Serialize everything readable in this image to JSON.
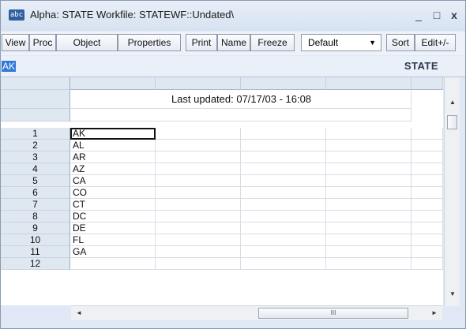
{
  "window": {
    "icon_text": "abc",
    "title": "Alpha: STATE   Workfile: STATEWF::Undated\\"
  },
  "title_controls": {
    "minimize": "_",
    "maximize": "□",
    "close": "x"
  },
  "toolbar": {
    "buttons": [
      "View",
      "Proc",
      "Object",
      "Properties",
      "Print",
      "Name",
      "Freeze"
    ],
    "display_select": "Default",
    "right_buttons": [
      "Sort",
      "Edit+/-"
    ]
  },
  "command_bar": {
    "selected_value": "AK",
    "series_name": "STATE"
  },
  "sheet": {
    "banner": "Last updated: 07/17/03 - 16:08",
    "rows": [
      {
        "obs": "1",
        "value": "AK"
      },
      {
        "obs": "2",
        "value": "AL"
      },
      {
        "obs": "3",
        "value": "AR"
      },
      {
        "obs": "4",
        "value": "AZ"
      },
      {
        "obs": "5",
        "value": "CA"
      },
      {
        "obs": "6",
        "value": "CO"
      },
      {
        "obs": "7",
        "value": "CT"
      },
      {
        "obs": "8",
        "value": "DC"
      },
      {
        "obs": "9",
        "value": "DE"
      },
      {
        "obs": "10",
        "value": "FL"
      },
      {
        "obs": "11",
        "value": "GA"
      },
      {
        "obs": "12",
        "value": ""
      }
    ]
  },
  "scrollbars": {
    "up": "▲",
    "down": "▼",
    "left": "◄",
    "right": "►",
    "grip": "III"
  },
  "colors": {
    "selection": "#3178d8",
    "header": "#dfe7f1"
  }
}
